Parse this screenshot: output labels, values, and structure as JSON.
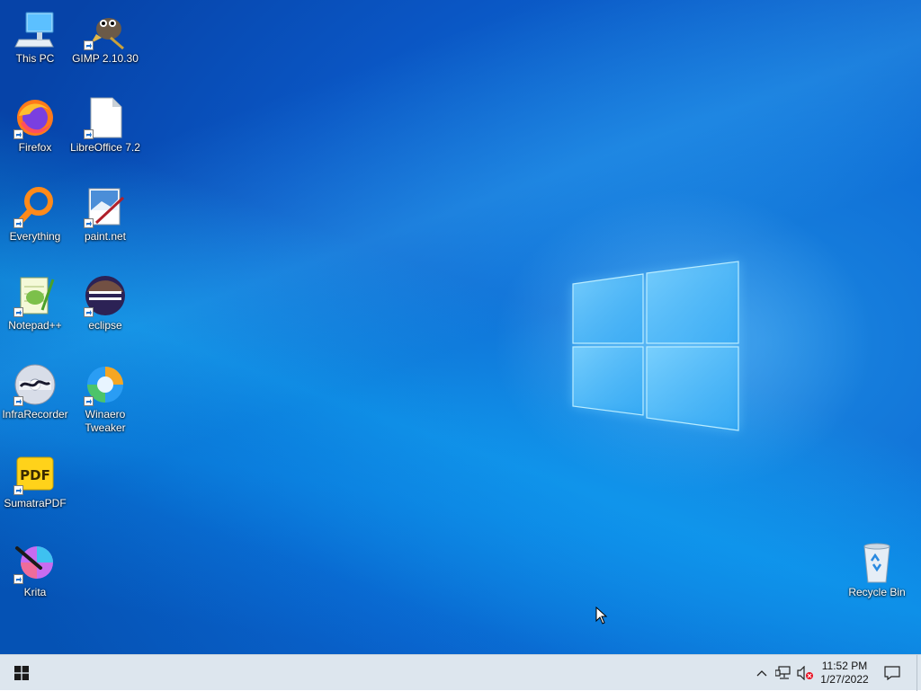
{
  "desktop": {
    "icons": [
      {
        "name": "this-pc",
        "label": "This PC"
      },
      {
        "name": "gimp",
        "label": "GIMP 2.10.30"
      },
      {
        "name": "firefox",
        "label": "Firefox"
      },
      {
        "name": "libreoffice",
        "label": "LibreOffice 7.2"
      },
      {
        "name": "everything",
        "label": "Everything"
      },
      {
        "name": "paint-net",
        "label": "paint.net"
      },
      {
        "name": "notepad-plus-plus",
        "label": "Notepad++"
      },
      {
        "name": "eclipse",
        "label": "eclipse"
      },
      {
        "name": "infrarecorder",
        "label": "InfraRecorder"
      },
      {
        "name": "winaero-tweaker",
        "label": "Winaero Tweaker"
      },
      {
        "name": "sumatrapdf",
        "label": "SumatraPDF"
      },
      {
        "name": "krita",
        "label": "Krita"
      },
      {
        "name": "recycle-bin",
        "label": "Recycle Bin"
      }
    ]
  },
  "taskbar": {
    "start_icon": "windows-logo-icon",
    "tray": {
      "overflow_icon": "chevron-up-icon",
      "network_icon": "network-icon",
      "volume_icon": "volume-muted-icon",
      "notification_icon": "action-center-icon"
    },
    "clock": {
      "time": "11:52 PM",
      "date": "1/27/2022"
    }
  },
  "colors": {
    "wallpaper_dark": "#0643a8",
    "wallpaper_light": "#1a86e0",
    "taskbar": "#dde6ee"
  }
}
